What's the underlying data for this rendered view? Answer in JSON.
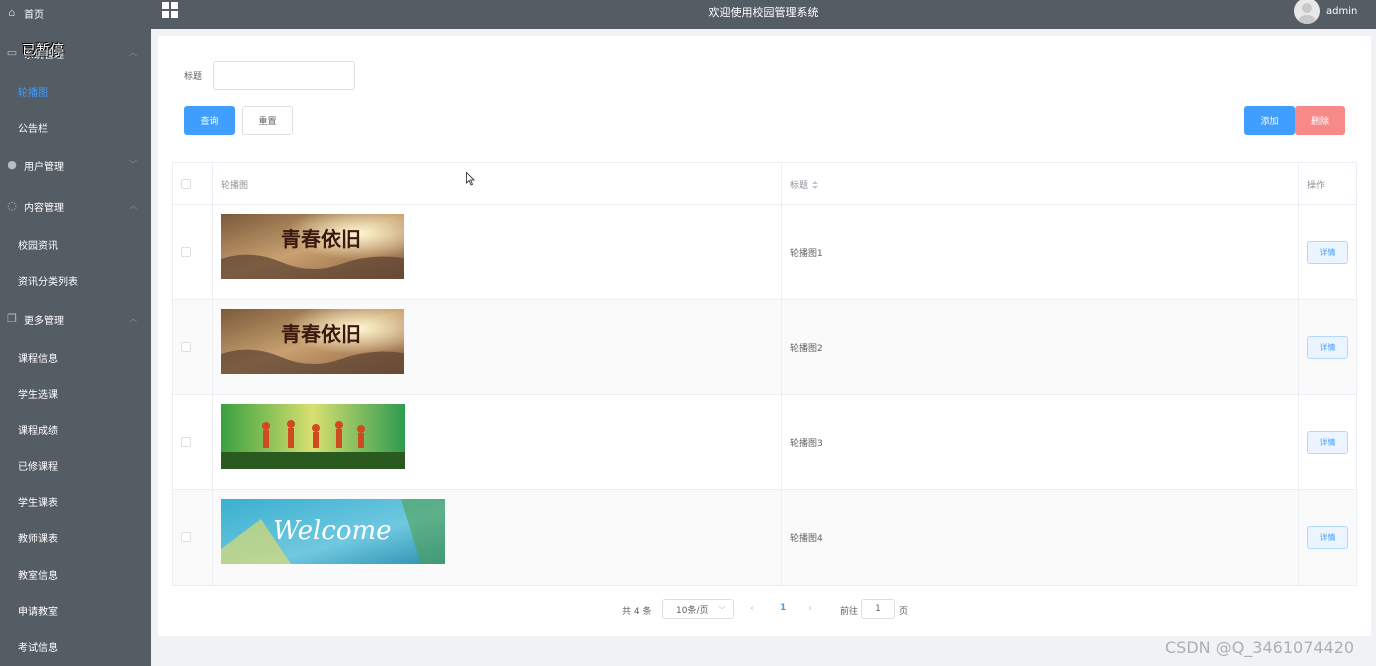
{
  "sidebar": {
    "paused_overlay": "已暂停",
    "home": "首页",
    "group_1": "系统管理",
    "group_1_items": [
      "轮播图",
      "公告栏"
    ],
    "group_2": "用户管理",
    "group_3": "内容管理",
    "group_3_items": [
      "校园资讯",
      "资讯分类列表"
    ],
    "group_4": "更多管理",
    "group_4_items": [
      "课程信息",
      "学生选课",
      "课程成绩",
      "已修课程",
      "学生课表",
      "教师课表",
      "教室信息",
      "申请教室",
      "考试信息"
    ]
  },
  "header": {
    "title": "欢迎使用校园管理系统",
    "user": "admin"
  },
  "filter": {
    "title_label": "标题",
    "title_value": "",
    "search_label": "查询",
    "reset_label": "重置",
    "add_label": "添加",
    "delete_label": "删除"
  },
  "table": {
    "headers": {
      "image": "轮播图",
      "title": "标题",
      "actions": "操作"
    },
    "rows": [
      {
        "title": "轮播图1",
        "image_text": "青春依旧",
        "action": "详情"
      },
      {
        "title": "轮播图2",
        "image_text": "青春依旧",
        "action": "详情"
      },
      {
        "title": "轮播图3",
        "image_text": "",
        "action": "详情"
      },
      {
        "title": "轮播图4",
        "image_text": "Welcome",
        "action": "详情"
      }
    ]
  },
  "pagination": {
    "total": "共 4 条",
    "page_size": "10条/页",
    "current_page": "1",
    "goto_label": "前往",
    "goto_value": "1",
    "goto_unit": "页"
  },
  "watermark": "CSDN @Q_3461074420",
  "colors": {
    "sidebar_bg": "#545c64",
    "primary": "#409eff",
    "danger": "#f78989"
  }
}
